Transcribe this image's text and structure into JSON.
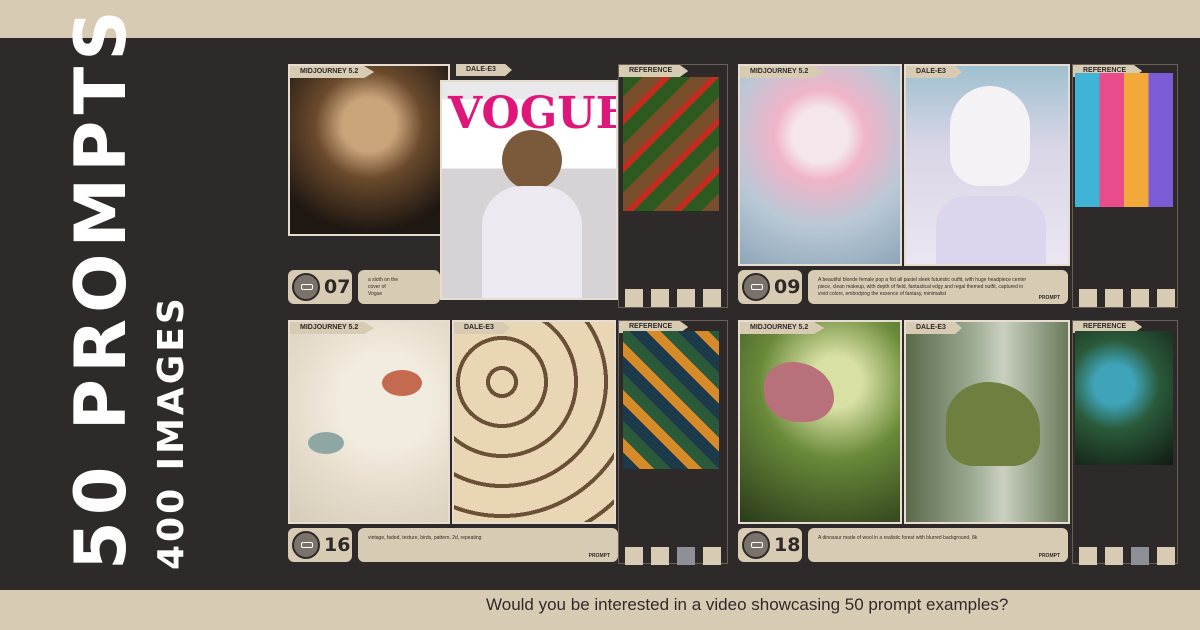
{
  "headline": "50 PROMPTS",
  "subheadline": "400 IMAGES",
  "question": "Would you be interested in a video showcasing 50 prompt examples?",
  "labels": {
    "midjourney": "MIDJOURNEY 5.2",
    "dalle": "DALE-E3",
    "reference": "REFERENCE",
    "prompt": "PROMPT"
  },
  "cards": [
    {
      "number": "07",
      "prompt": "a sloth on the cover of Vogue",
      "squares": [
        "beige",
        "beige",
        "beige",
        "beige"
      ]
    },
    {
      "number": "09",
      "prompt": "A beautiful blonde female pop a fist all pastel sleek futuristic outfit, with huge headpiece center piece, clean makeup, with depth of field, fantastical edgy and regal themed outfit, captured in vivid colors, embodying the essence of fantasy, minimalist",
      "squares": [
        "beige",
        "beige",
        "beige",
        "beige"
      ]
    },
    {
      "number": "16",
      "prompt": "vintage, faded, texture, birds, pattern, 2d, repeating",
      "squares": [
        "beige",
        "beige",
        "gray",
        "beige"
      ]
    },
    {
      "number": "18",
      "prompt": "A dinosaur made of wool in a realistic forest with blurred background, 8k",
      "squares": [
        "beige",
        "beige",
        "gray",
        "beige"
      ]
    }
  ],
  "colors": {
    "background": "#2f2a2a",
    "accent": "#d8cbb3",
    "text_light": "#ffffff"
  }
}
